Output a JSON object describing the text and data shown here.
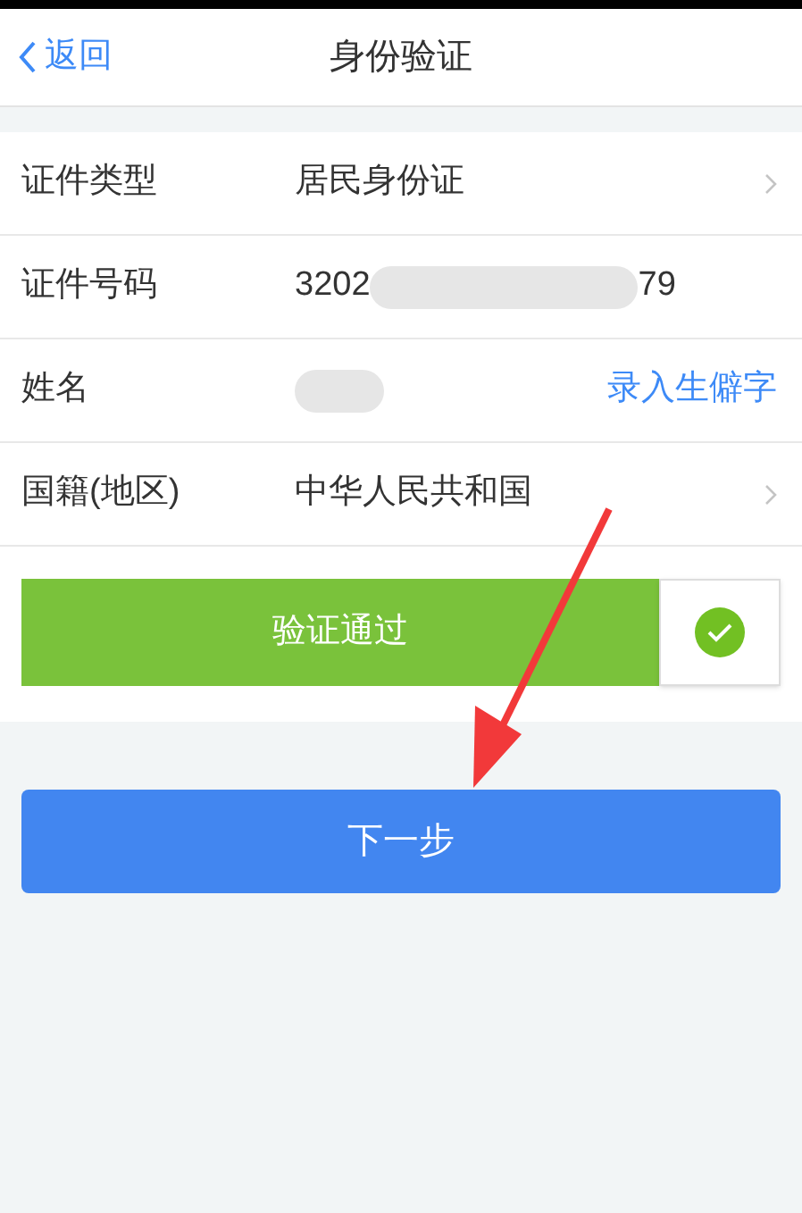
{
  "nav": {
    "back": "返回",
    "title": "身份验证"
  },
  "rows": [
    {
      "kind": "select",
      "label": "证件类型",
      "value": "居民身份证"
    },
    {
      "kind": "masked",
      "label": "证件号码",
      "value_start": "3202",
      "value_end": "79"
    },
    {
      "kind": "masked-link",
      "label": "姓名",
      "link": "录入生僻字"
    },
    {
      "kind": "select",
      "label": "国籍(地区)",
      "value": "中华人民共和国"
    }
  ],
  "verify": {
    "label": "验证通过",
    "passed": true
  },
  "next_button": "下一步"
}
